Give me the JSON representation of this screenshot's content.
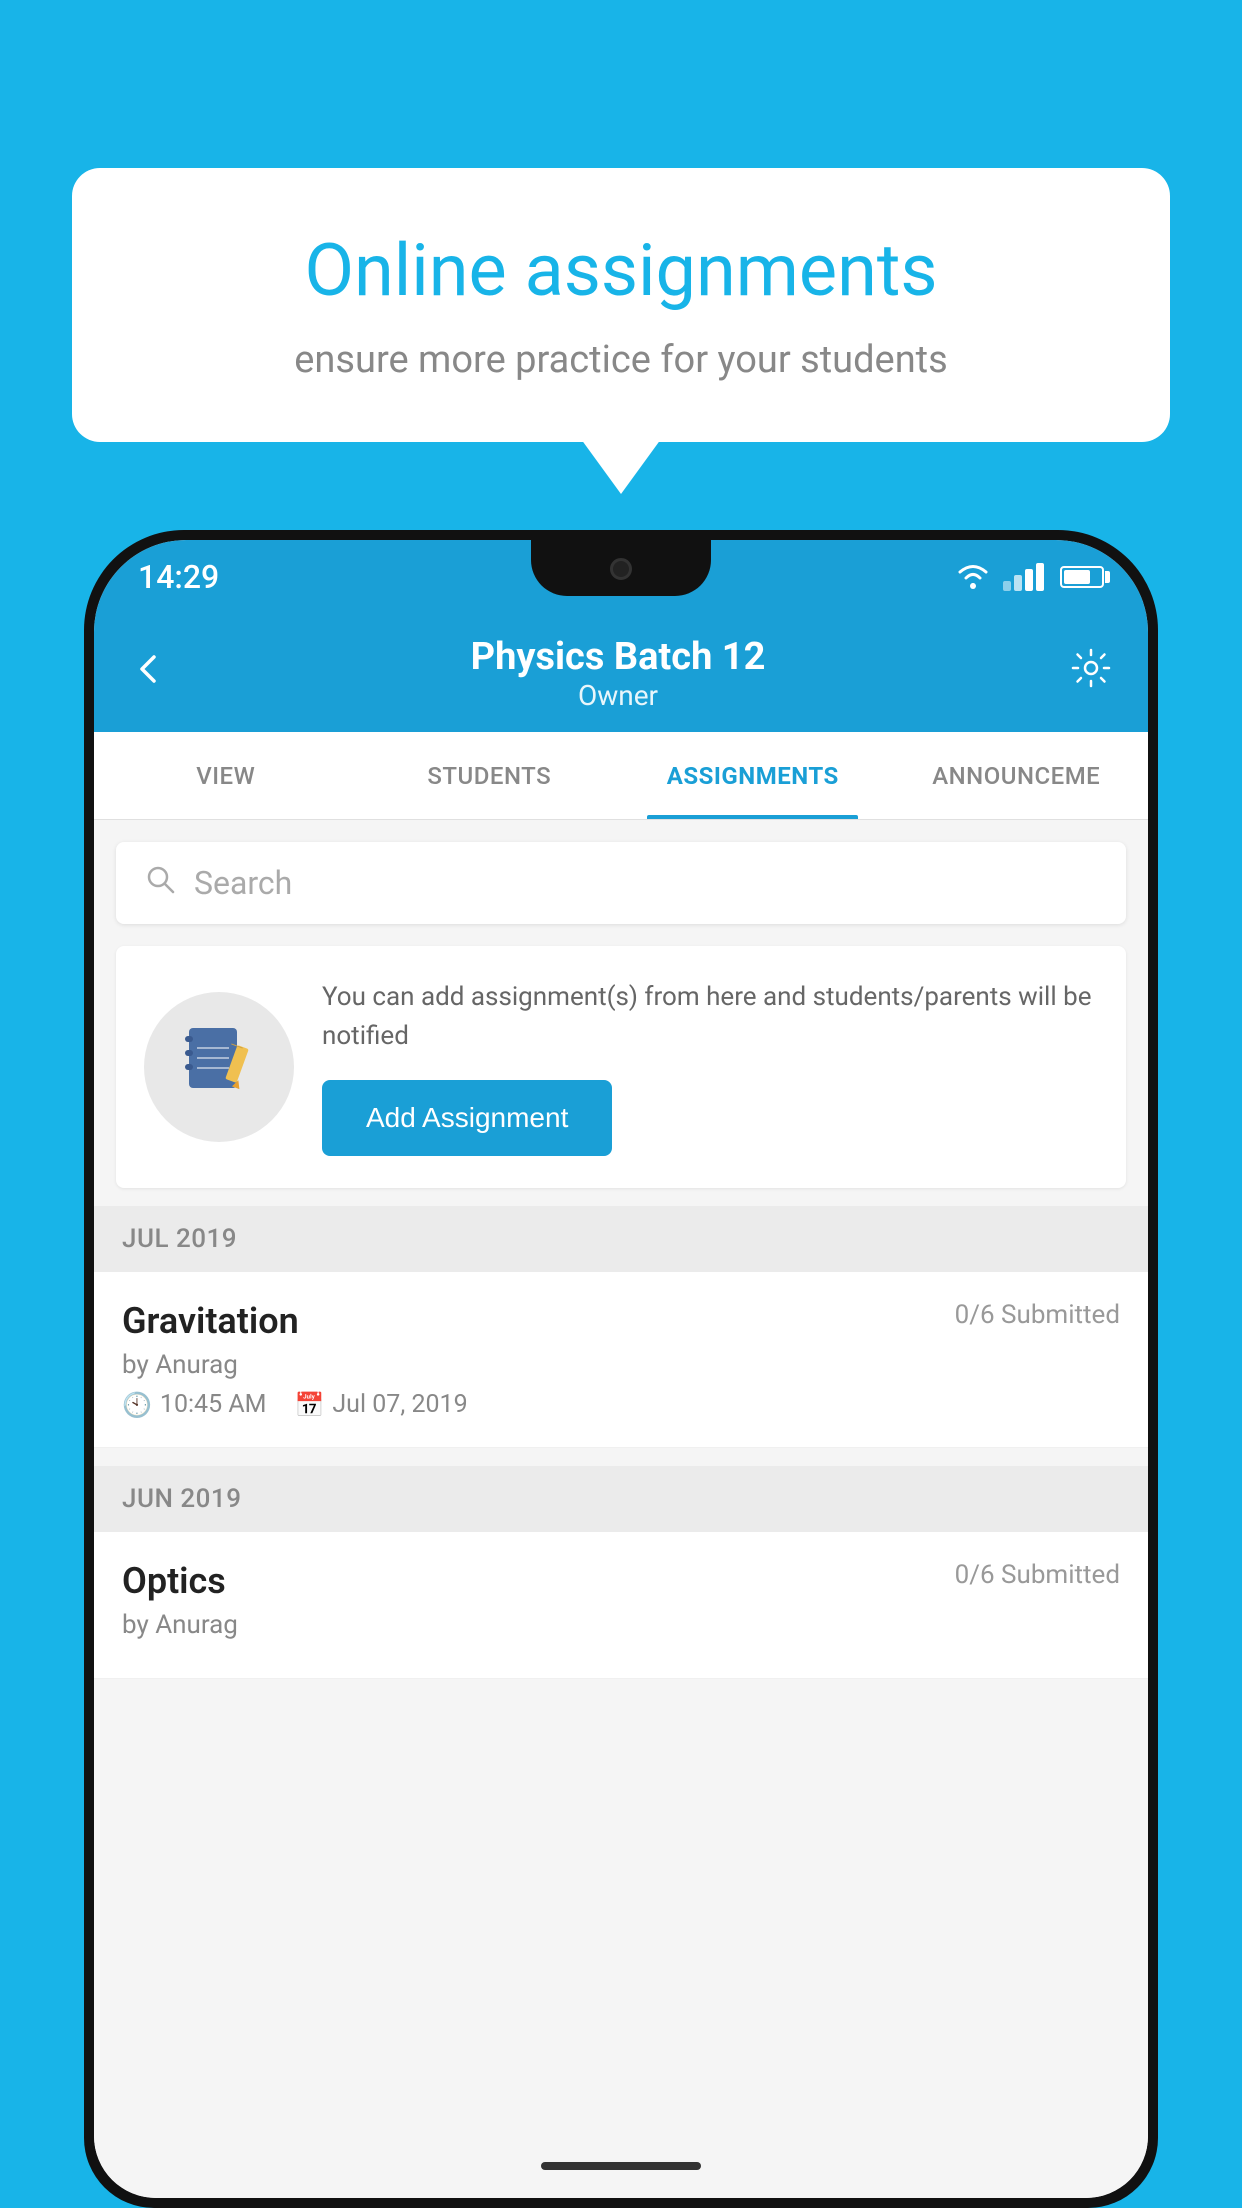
{
  "background": {
    "color": "#18b4e8"
  },
  "promo": {
    "title": "Online assignments",
    "subtitle": "ensure more practice for your students"
  },
  "status_bar": {
    "time": "14:29"
  },
  "header": {
    "title": "Physics Batch 12",
    "subtitle": "Owner",
    "back_label": "←",
    "settings_label": "⚙"
  },
  "tabs": [
    {
      "id": "view",
      "label": "VIEW",
      "active": false
    },
    {
      "id": "students",
      "label": "STUDENTS",
      "active": false
    },
    {
      "id": "assignments",
      "label": "ASSIGNMENTS",
      "active": true
    },
    {
      "id": "announcements",
      "label": "ANNOUNCEME",
      "active": false
    }
  ],
  "search": {
    "placeholder": "Search"
  },
  "add_assignment": {
    "description": "You can add assignment(s) from here and students/parents will be notified",
    "button_label": "Add Assignment"
  },
  "months": [
    {
      "label": "JUL 2019",
      "assignments": [
        {
          "name": "Gravitation",
          "submitted": "0/6 Submitted",
          "author": "by Anurag",
          "time": "10:45 AM",
          "date": "Jul 07, 2019"
        }
      ]
    },
    {
      "label": "JUN 2019",
      "assignments": [
        {
          "name": "Optics",
          "submitted": "0/6 Submitted",
          "author": "by Anurag",
          "time": "",
          "date": ""
        }
      ]
    }
  ]
}
